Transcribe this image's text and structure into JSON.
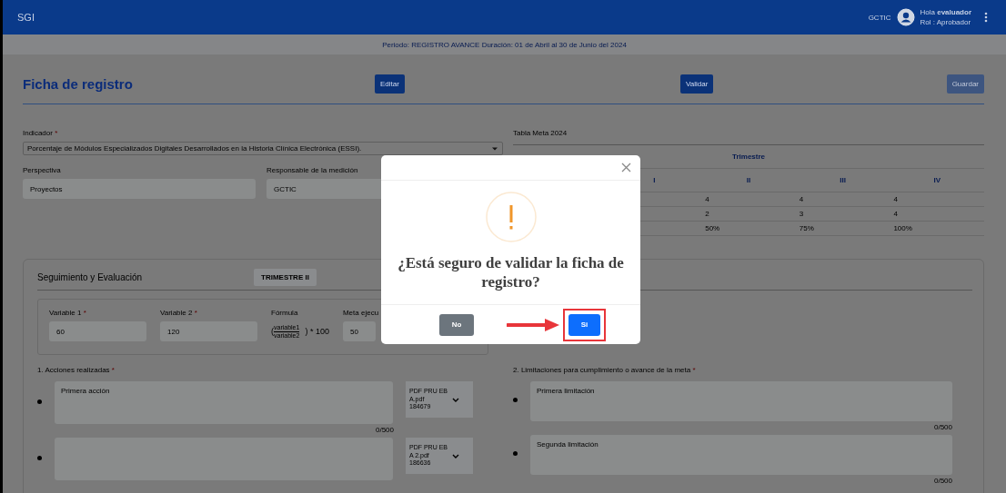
{
  "header": {
    "brand": "SGI",
    "org": "GCTIC",
    "greeting": "Hola **evaluador**",
    "role": "Rol : Aprobador"
  },
  "period_bar": "Periodo: REGISTRO AVANCE Duración: 01 de Abril al 30 de Junio del 2024",
  "page": {
    "title": "Ficha de registro",
    "buttons": [
      {
        "label": "Editar",
        "disabled": false
      },
      {
        "label": "Validar",
        "disabled": false
      },
      {
        "label": "Guardar",
        "disabled": true
      }
    ]
  },
  "indicator": {
    "label": "Indicador",
    "required_mark": "*",
    "value": "Porcentaje de Módulos Especializados Digitales Desarrollados en la Historia Clínica Electrónica (ESSI)."
  },
  "perspective": {
    "label": "Perspectiva",
    "value": "Proyectos"
  },
  "responsible": {
    "label": "Responsable de la medición",
    "value": "GCTIC"
  },
  "goal_table": {
    "title": "Tabla Meta 2024",
    "group_header": "Trimestre",
    "columns": [
      "I",
      "II",
      "III",
      "IV"
    ],
    "rows": [
      [
        "",
        "4",
        "4",
        "4"
      ],
      [
        "",
        "2",
        "3",
        "4"
      ],
      [
        "",
        "50%",
        "75%",
        "100%"
      ]
    ]
  },
  "tracking": {
    "title": "Seguimiento y Evaluación",
    "quarter_badge": "TRIMESTRE II",
    "variables": [
      {
        "label": "Variable 1",
        "required_mark": "*",
        "value": "60"
      },
      {
        "label": "Variable 2",
        "required_mark": "*",
        "value": "120"
      }
    ],
    "formula": {
      "label": "Fórmula",
      "open": "(",
      "numerator": "variable1",
      "denominator": "variable2",
      "suffix": ") * 100"
    },
    "goal_executed": {
      "label": "Meta ejecu",
      "value": "50"
    },
    "actions": {
      "label": "1. Acciones realizadas",
      "required_mark": "*",
      "items": [
        {
          "text": "Primera acción",
          "file": "PDF PRU EBA.pdf",
          "file_size": "184679",
          "counter": "0/500"
        },
        {
          "file": "PDF PRU EBA 2.pdf",
          "file_size": "186636"
        }
      ]
    },
    "limitations": {
      "label": "2. Limitaciones para cumplimiento o avance de la meta",
      "required_mark": "*",
      "items": [
        {
          "text": "Primera limitación",
          "counter": "0/500"
        },
        {
          "text": "Segunda limitación",
          "counter": "0/500"
        }
      ]
    }
  },
  "modal": {
    "message": "¿Está seguro de validar la ficha de registro?",
    "buttons": [
      {
        "label": "No",
        "kind": "cancel",
        "highlighted": false
      },
      {
        "label": "Si",
        "kind": "confirm",
        "highlighted": true
      }
    ]
  }
}
